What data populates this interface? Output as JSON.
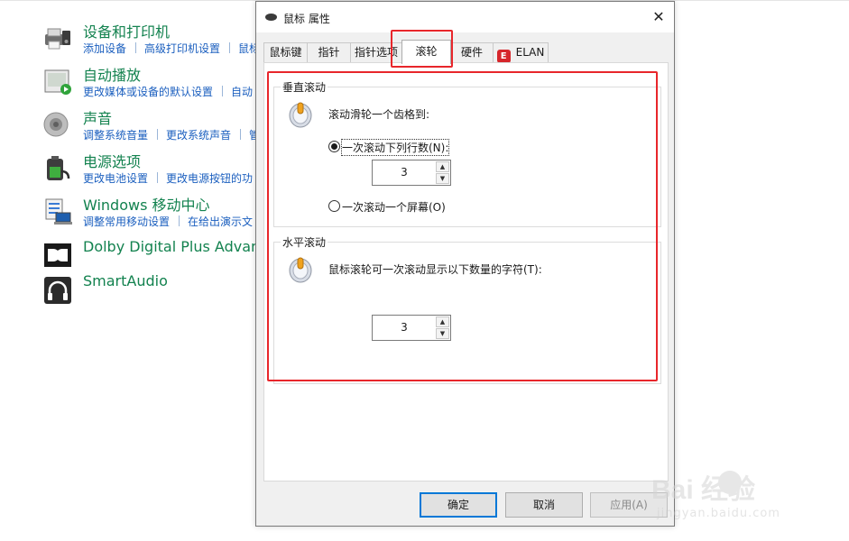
{
  "control_panel": {
    "items": [
      {
        "title": "设备和打印机",
        "links": [
          "添加设备",
          "高级打印机设置",
          "鼠标"
        ],
        "icon": "printer-icon"
      },
      {
        "title": "自动播放",
        "links": [
          "更改媒体或设备的默认设置",
          "自动"
        ],
        "icon": "autoplay-icon"
      },
      {
        "title": "声音",
        "links": [
          "调整系统音量",
          "更改系统声音",
          "管"
        ],
        "icon": "speaker-icon"
      },
      {
        "title": "电源选项",
        "links": [
          "更改电池设置",
          "更改电源按钮的功"
        ],
        "icon": "battery-icon"
      },
      {
        "title": "Windows 移动中心",
        "links": [
          "调整常用移动设置",
          "在给出演示文"
        ],
        "icon": "mobility-center-icon"
      },
      {
        "title": "Dolby Digital Plus Advanc",
        "links": [],
        "icon": "dolby-icon"
      },
      {
        "title": "SmartAudio",
        "links": [],
        "icon": "smartaudio-icon"
      }
    ]
  },
  "dialog": {
    "title": "鼠标 属性",
    "close_glyph": "✕",
    "tabs": [
      {
        "label": "鼠标键",
        "active": false
      },
      {
        "label": "指针",
        "active": false
      },
      {
        "label": "指针选项",
        "active": false
      },
      {
        "label": "滚轮",
        "active": true
      },
      {
        "label": "硬件",
        "active": false
      },
      {
        "label": "ELAN",
        "active": false
      }
    ],
    "elan_logo_letter": "E",
    "vertical": {
      "group_label": "垂直滚动",
      "prompt": "滚动滑轮一个齿格到:",
      "option_lines": "一次滚动下列行数(N):",
      "option_lines_selected": true,
      "lines_value": "3",
      "option_screen": "一次滚动一个屏幕(O)",
      "option_screen_selected": false
    },
    "horizontal": {
      "group_label": "水平滚动",
      "prompt": "鼠标滚轮可一次滚动显示以下数量的字符(T):",
      "chars_value": "3"
    },
    "spin_up_glyph": "▲",
    "spin_down_glyph": "▼",
    "buttons": {
      "ok": "确定",
      "cancel": "取消",
      "apply": "应用(A)"
    }
  },
  "watermark": {
    "main": "Bai  经验",
    "sub": "jingyan.baidu.com"
  },
  "colors": {
    "annotation_red": "#e8262b",
    "link_blue": "#1b5fbf",
    "title_green": "#13824f",
    "default_button_border": "#0078d7"
  }
}
